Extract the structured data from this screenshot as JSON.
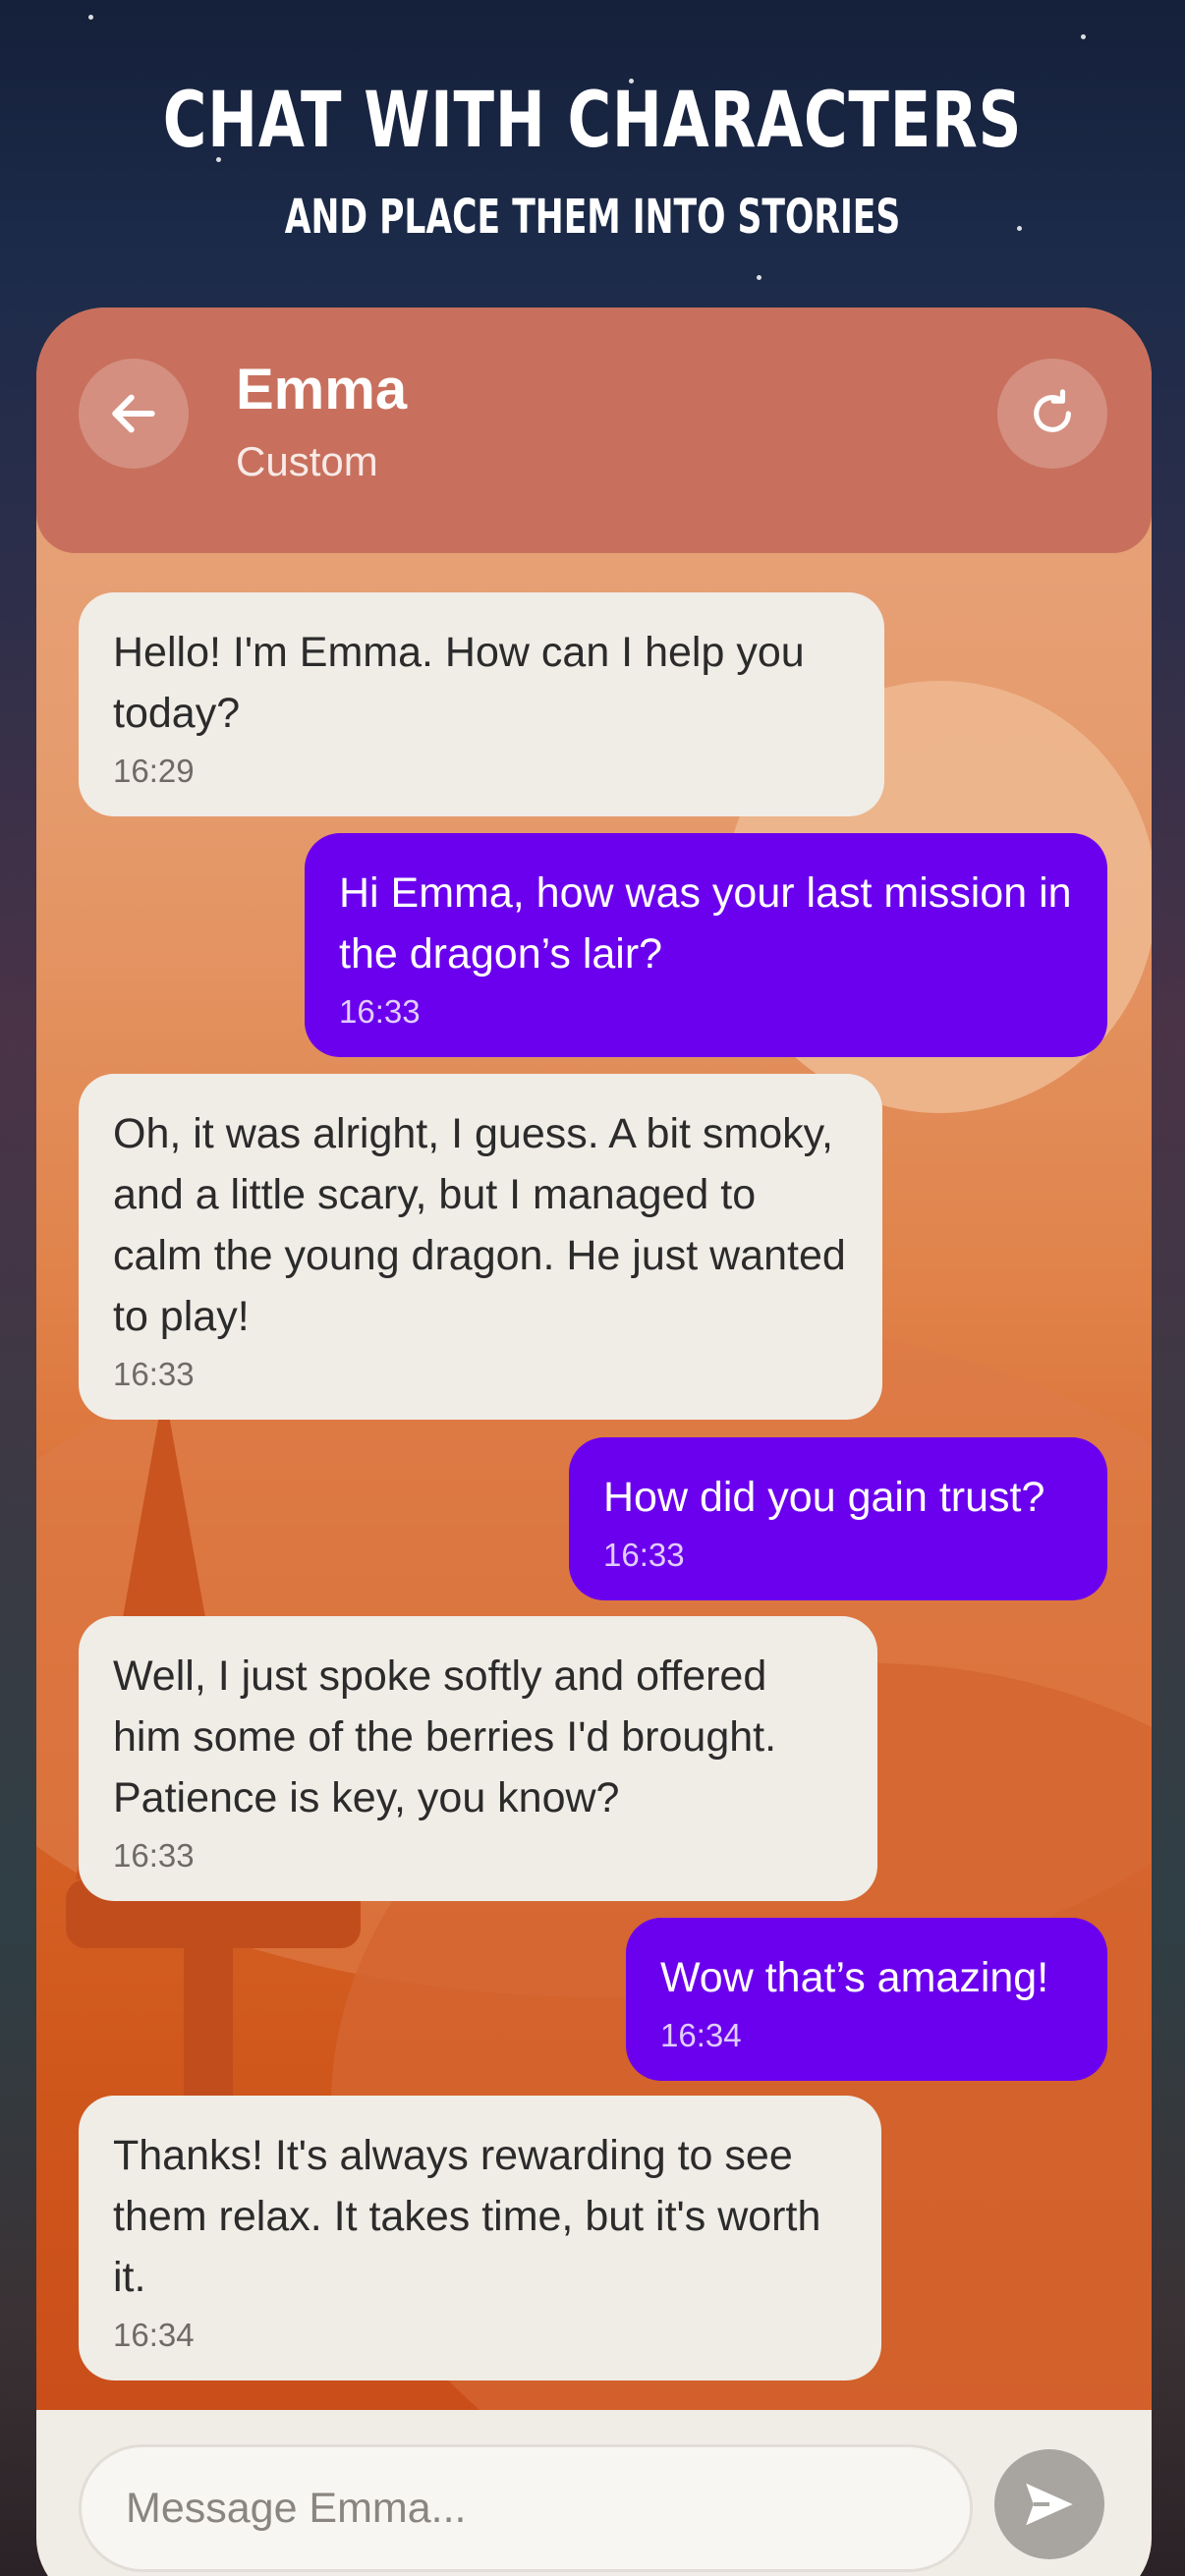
{
  "promo": {
    "headline": "CHAT WITH CHARACTERS",
    "subheadline": "AND PLACE THEM INTO STORIES"
  },
  "header": {
    "name": "Emma",
    "subtitle": "Custom",
    "back_icon": "arrow-left-icon",
    "refresh_icon": "refresh-icon"
  },
  "messages": [
    {
      "from": "character",
      "text": "Hello! I'm Emma. How can I help you today?",
      "time": "16:29"
    },
    {
      "from": "user",
      "text": "Hi Emma, how was your last mission in the dragon’s lair?",
      "time": "16:33"
    },
    {
      "from": "character",
      "text": "Oh, it was alright, I guess. A bit smoky, and a little scary, but I managed to calm the young dragon. He just wanted to play!",
      "time": "16:33"
    },
    {
      "from": "user",
      "text": "How did you gain trust?",
      "time": "16:33"
    },
    {
      "from": "character",
      "text": "Well, I just spoke softly and offered him some of the berries I'd brought. Patience is key, you know?",
      "time": "16:33"
    },
    {
      "from": "user",
      "text": "Wow that’s amazing!",
      "time": "16:34"
    },
    {
      "from": "character",
      "text": "Thanks! It's always rewarding to see them relax. It takes time, but it's worth it.",
      "time": "16:34"
    }
  ],
  "composer": {
    "placeholder": "Message Emma...",
    "value": "",
    "send_icon": "send-icon"
  },
  "colors": {
    "user_bubble": "#6b00ee",
    "character_bubble": "#f0ece6",
    "header": "#c8705d"
  }
}
